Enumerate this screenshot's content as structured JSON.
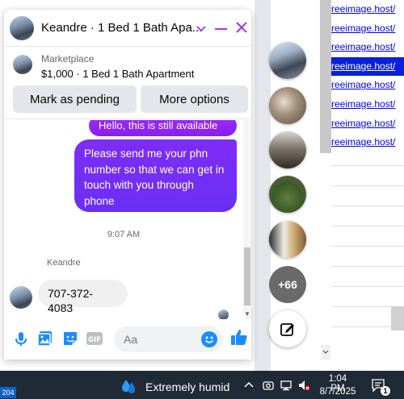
{
  "background": {
    "links": [
      "reeimage.host/",
      "reeimage.host/",
      "reeimage.host/",
      "reeimage.host/",
      "reeimage.host/",
      "reeimage.host/",
      "reeimage.host/",
      "reeimage.host/"
    ],
    "selected_link_index": 3
  },
  "chat": {
    "title": "Keandre · 1 Bed 1 Bath Apa...",
    "marketplace": {
      "label": "Marketplace",
      "item": "$1,000 · 1 Bed 1 Bath Apartment",
      "pending_button": "Mark as pending",
      "more_button": "More options"
    },
    "messages": {
      "outgoing_1": "Hello, this is still available",
      "outgoing_2": "Please send me your phn number so that we can get in touch with you through phone",
      "timestamp": "9:07 AM",
      "sender": "Keandre",
      "incoming_1": "707-372-4083"
    },
    "composer": {
      "placeholder": "Aa"
    }
  },
  "chat_heads": {
    "more_count": "+66"
  },
  "taskbar": {
    "badge": "204",
    "weather": "Extremely humid",
    "time": "1:04 PM",
    "date": "8/7/2025",
    "notification_count": "1"
  },
  "colors": {
    "accent": "#a033ff",
    "bubble_out": "#7d2df6",
    "messenger_blue": "#1b8cff"
  }
}
